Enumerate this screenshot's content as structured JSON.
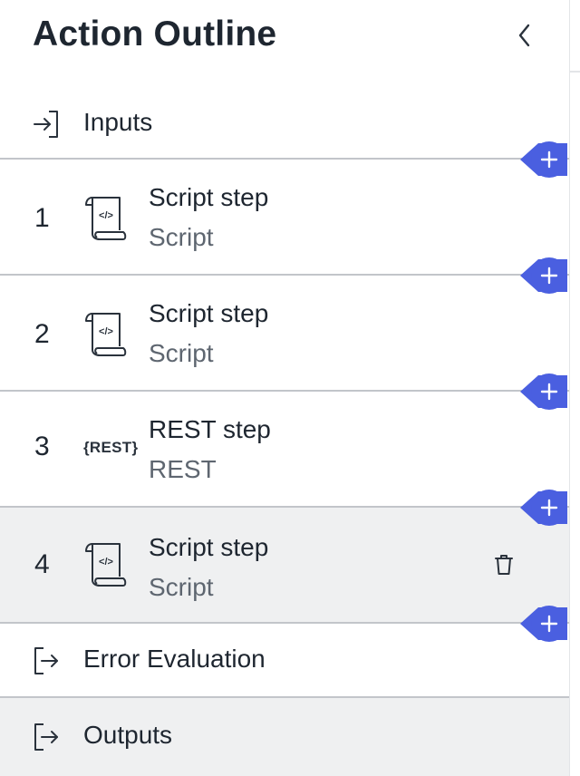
{
  "panel": {
    "title": "Action Outline"
  },
  "colors": {
    "accent": "#4a5fe0",
    "divider": "#c2c5ca",
    "selected_row": "#eff0f1",
    "secondary_text": "#5e6670"
  },
  "inputs": {
    "label": "Inputs",
    "icon": "sign-in-icon"
  },
  "steps": [
    {
      "number": "1",
      "title": "Script step",
      "type": "Script",
      "icon": "script-scroll-icon"
    },
    {
      "number": "2",
      "title": "Script step",
      "type": "Script",
      "icon": "script-scroll-icon"
    },
    {
      "number": "3",
      "title": "REST step",
      "type": "REST",
      "icon_text": "{REST}"
    },
    {
      "number": "4",
      "title": "Script step",
      "type": "Script",
      "icon": "script-scroll-icon",
      "selected": true
    }
  ],
  "error_evaluation": {
    "label": "Error Evaluation",
    "icon": "sign-out-icon"
  },
  "outputs": {
    "label": "Outputs",
    "icon": "sign-out-icon"
  },
  "add_button_icon": "plus-icon"
}
